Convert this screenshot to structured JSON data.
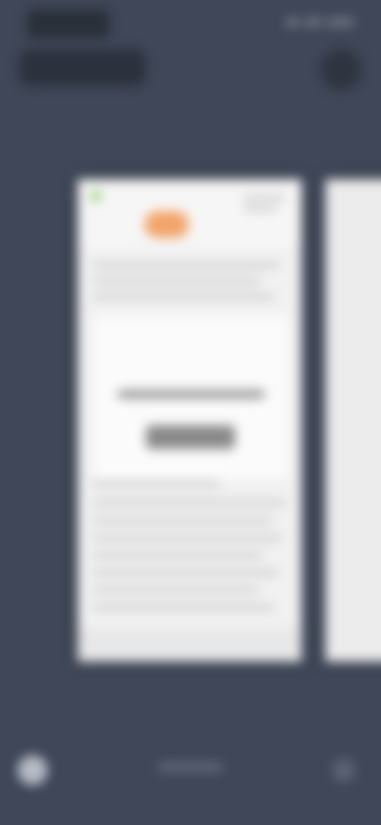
{
  "status_bar": {
    "time": "",
    "icons": [
      "wifi-icon",
      "signal-icon",
      "battery-icon"
    ]
  },
  "top_bar": {
    "chip_label": "",
    "action_icon": "more-icon"
  },
  "cards": {
    "main": {
      "app_name": "",
      "title": "",
      "button_label": "",
      "footer_label": ""
    },
    "next": {
      "app_name": ""
    }
  },
  "bottom_nav": {
    "left_icon": "home-icon",
    "center_label": "",
    "right_icon": "menu-icon"
  },
  "colors": {
    "background": "#3f4758",
    "card": "#f1f1f1",
    "accent": "#f3a46a"
  }
}
